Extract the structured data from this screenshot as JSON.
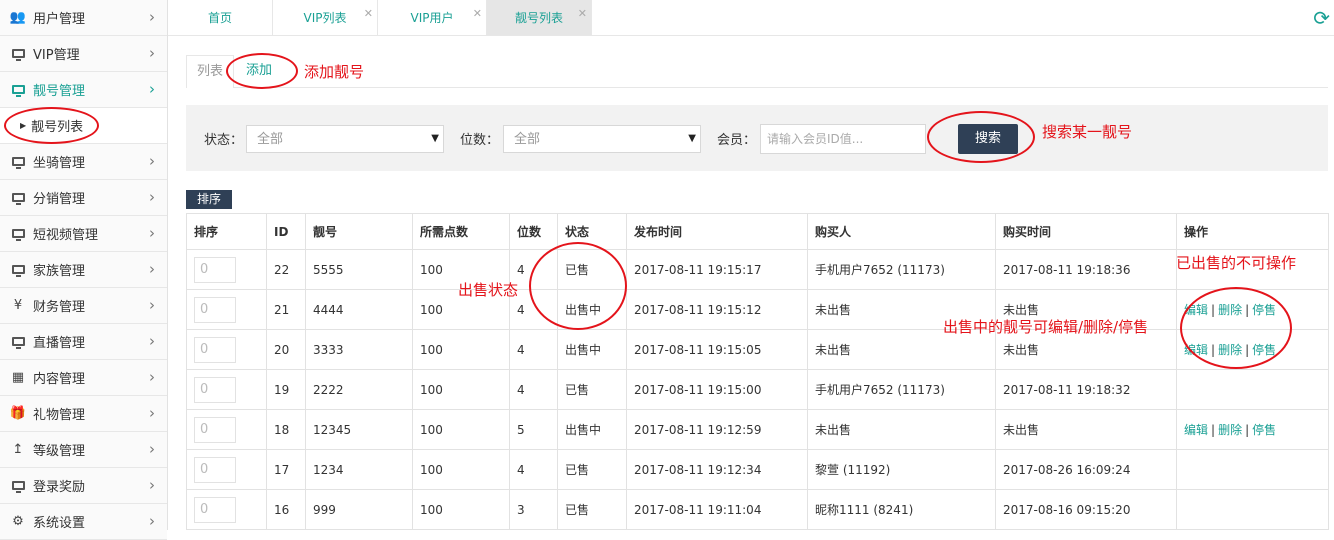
{
  "sidebar": {
    "items": [
      {
        "label": "用户管理",
        "icon": "users-icon"
      },
      {
        "label": "VIP管理",
        "icon": "monitor-icon"
      },
      {
        "label": "靓号管理",
        "icon": "monitor-icon",
        "active": true
      },
      {
        "label": "坐骑管理",
        "icon": "monitor-icon"
      },
      {
        "label": "分销管理",
        "icon": "monitor-icon"
      },
      {
        "label": "短视频管理",
        "icon": "monitor-icon"
      },
      {
        "label": "家族管理",
        "icon": "monitor-icon"
      },
      {
        "label": "财务管理",
        "icon": "yen-icon"
      },
      {
        "label": "直播管理",
        "icon": "monitor-icon"
      },
      {
        "label": "内容管理",
        "icon": "grid-icon"
      },
      {
        "label": "礼物管理",
        "icon": "gift-icon"
      },
      {
        "label": "等级管理",
        "icon": "level-up-icon"
      },
      {
        "label": "登录奖励",
        "icon": "monitor-icon"
      },
      {
        "label": "系统设置",
        "icon": "gear-icon"
      }
    ],
    "submenu_label": "靓号列表"
  },
  "tabs": [
    {
      "label": "首页"
    },
    {
      "label": "VIP列表"
    },
    {
      "label": "VIP用户"
    },
    {
      "label": "靓号列表",
      "active": true
    }
  ],
  "subtabs": {
    "list": "列表",
    "add": "添加"
  },
  "search": {
    "status_label": "状态：",
    "status_value": "全部",
    "digits_label": "位数：",
    "digits_value": "全部",
    "member_label": "会员：",
    "member_placeholder": "请输入会员ID值...",
    "button": "搜索"
  },
  "sort_button": "排序",
  "table": {
    "headers": [
      "排序",
      "ID",
      "靓号",
      "所需点数",
      "位数",
      "状态",
      "发布时间",
      "购买人",
      "购买时间",
      "操作"
    ],
    "rows": [
      {
        "sort": "0",
        "id": "22",
        "number": "5555",
        "points": "100",
        "digits": "4",
        "status": "已售",
        "publish": "2017-08-11 19:15:17",
        "buyer": "手机用户7652 (11173)",
        "buy_time": "2017-08-11 19:18:36",
        "ops": false
      },
      {
        "sort": "0",
        "id": "21",
        "number": "4444",
        "points": "100",
        "digits": "4",
        "status": "出售中",
        "publish": "2017-08-11 19:15:12",
        "buyer": "未出售",
        "buy_time": "未出售",
        "ops": true
      },
      {
        "sort": "0",
        "id": "20",
        "number": "3333",
        "points": "100",
        "digits": "4",
        "status": "出售中",
        "publish": "2017-08-11 19:15:05",
        "buyer": "未出售",
        "buy_time": "未出售",
        "ops": true
      },
      {
        "sort": "0",
        "id": "19",
        "number": "2222",
        "points": "100",
        "digits": "4",
        "status": "已售",
        "publish": "2017-08-11 19:15:00",
        "buyer": "手机用户7652 (11173)",
        "buy_time": "2017-08-11 19:18:32",
        "ops": false
      },
      {
        "sort": "0",
        "id": "18",
        "number": "12345",
        "points": "100",
        "digits": "5",
        "status": "出售中",
        "publish": "2017-08-11 19:12:59",
        "buyer": "未出售",
        "buy_time": "未出售",
        "ops": true
      },
      {
        "sort": "0",
        "id": "17",
        "number": "1234",
        "points": "100",
        "digits": "4",
        "status": "已售",
        "publish": "2017-08-11 19:12:34",
        "buyer": "黎萱 (11192)",
        "buy_time": "2017-08-26 16:09:24",
        "ops": false
      },
      {
        "sort": "0",
        "id": "16",
        "number": "999",
        "points": "100",
        "digits": "3",
        "status": "已售",
        "publish": "2017-08-11 19:11:04",
        "buyer": "昵称1111 (8241)",
        "buy_time": "2017-08-16 09:15:20",
        "ops": false
      }
    ],
    "op_edit": "编辑",
    "op_delete": "删除",
    "op_stop": "停售",
    "op_sep": "|"
  },
  "annotations": {
    "add_number": "添加靓号",
    "search_number": "搜索某一靓号",
    "sale_status": "出售状态",
    "sold_no_ops": "已出售的不可操作",
    "onsale_ops": "出售中的靓号可编辑/删除/停售"
  },
  "colors": {
    "accent": "#1aa094",
    "button": "#2f4056",
    "annotation": "#e4141b"
  }
}
